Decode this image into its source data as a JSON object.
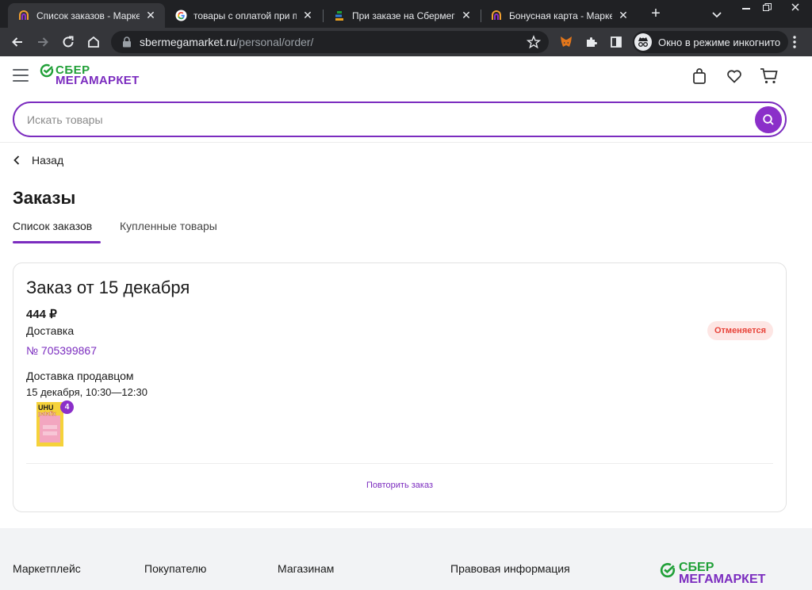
{
  "browser": {
    "tabs": [
      {
        "title": "Список заказов - Маркетпл",
        "favicon": "sbermegamarket-favicon",
        "active": true
      },
      {
        "title": "товары с оплатой при пол",
        "favicon": "google-favicon",
        "active": false
      },
      {
        "title": "При заказе на Сбермегама",
        "favicon": "bars-favicon",
        "active": false
      },
      {
        "title": "Бонусная карта - Маркетпл",
        "favicon": "sbermegamarket-favicon",
        "active": false
      }
    ],
    "address": {
      "domain": "sbermegamarket.ru",
      "path": "/personal/order/"
    },
    "incognito_label": "Окно в режиме инкогнито"
  },
  "site": {
    "logo": {
      "line1": "СБЕР",
      "line2": "МЕГАМАРКЕТ"
    },
    "search": {
      "placeholder": "Искать товары"
    },
    "back_label": "Назад",
    "page_title": "Заказы",
    "tabs": [
      {
        "label": "Список заказов",
        "active": true
      },
      {
        "label": "Купленные товары",
        "active": false
      }
    ]
  },
  "order": {
    "title": "Заказ от 15 декабря",
    "price": "444 ₽",
    "delivery_type": "Доставка",
    "number": "№ 705399867",
    "status": "Отменяется",
    "delivery_by": "Доставка продавцом",
    "delivery_window": "15 декабря, 10:30—12:30",
    "item_quantity": "4",
    "product_brand": "UHU",
    "product_name": "patafix",
    "repeat_label": "Повторить заказ"
  },
  "footer": {
    "columns": [
      "Маркетплейс",
      "Покупателю",
      "Магазинам",
      "Правовая информация"
    ],
    "logo": {
      "line1": "СБЕР",
      "line2": "МЕГАМАРКЕТ"
    }
  },
  "colors": {
    "accent": "#7b2cbf",
    "brand_green": "#21a038",
    "status_red": "#e8443a",
    "status_bg": "#fde6e4"
  }
}
